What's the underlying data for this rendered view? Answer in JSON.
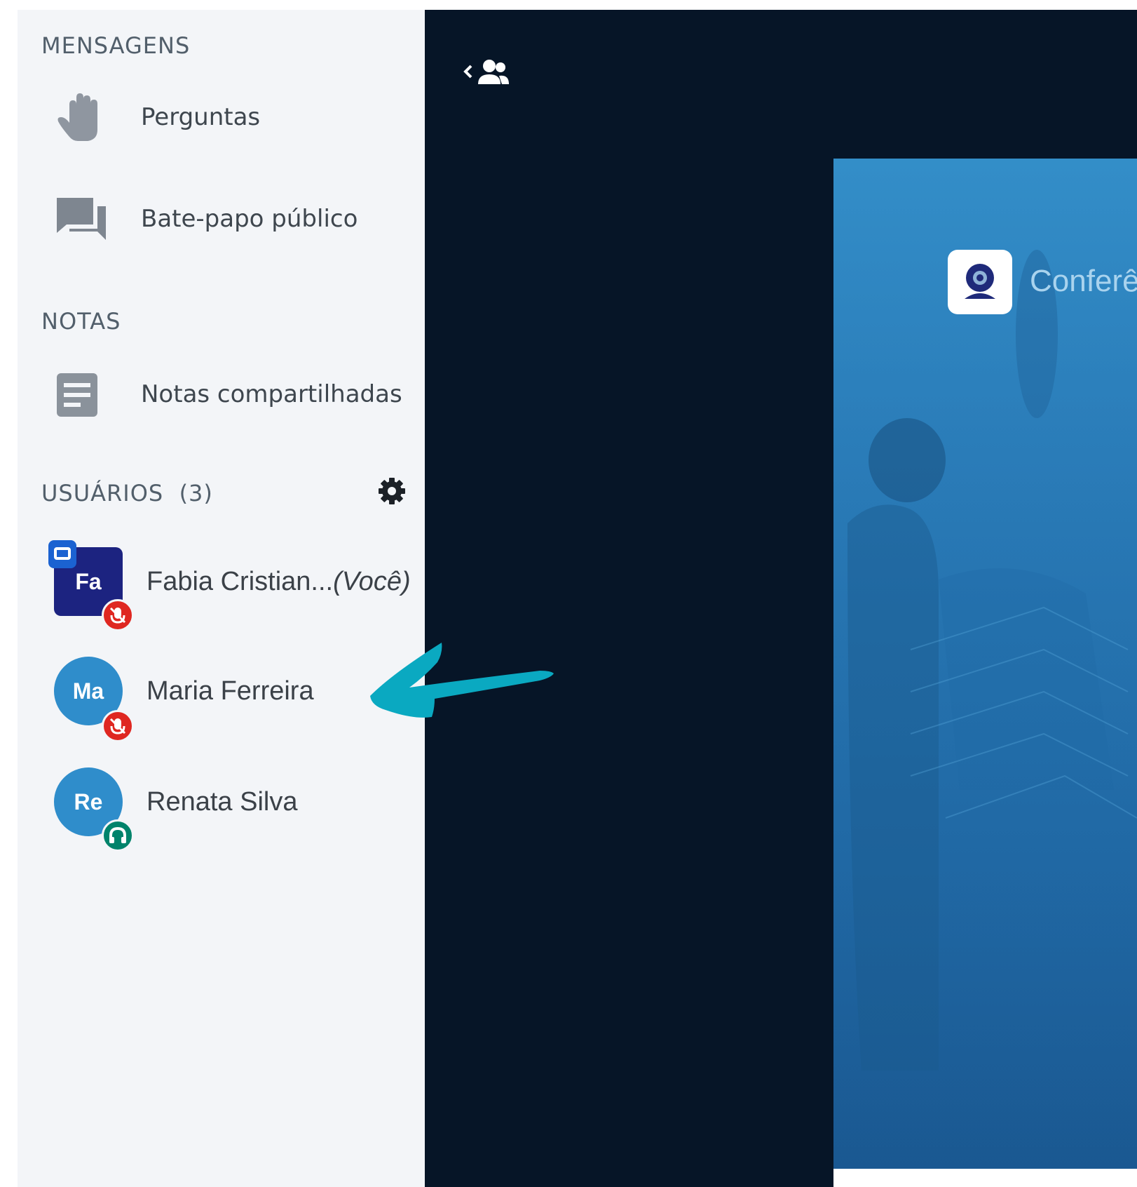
{
  "sidebar": {
    "messages_title": "MENSAGENS",
    "messages": [
      {
        "label": "Perguntas",
        "icon": "hand-icon"
      },
      {
        "label": "Bate-papo público",
        "icon": "chat-icon"
      }
    ],
    "notes_title": "NOTAS",
    "notes": [
      {
        "label": "Notas compartilhadas",
        "icon": "notes-icon"
      }
    ],
    "users_title": "USUÁRIOS",
    "users_count": "(3)",
    "users": [
      {
        "initials": "Fa",
        "name": "Fabia Cristian...",
        "suffix": "(Você)",
        "avatar_color": "#1c2380",
        "status": "microphone-muted",
        "status_color": "#df2721",
        "presenter": true
      },
      {
        "initials": "Ma",
        "name": "Maria Ferreira",
        "suffix": "",
        "avatar_color": "#2f8dcb",
        "status": "microphone-muted",
        "status_color": "#df2721",
        "presenter": false
      },
      {
        "initials": "Re",
        "name": "Renata Silva",
        "suffix": "",
        "avatar_color": "#2f8dcb",
        "status": "listen-only",
        "status_color": "#00836b",
        "presenter": false
      }
    ]
  },
  "main": {
    "presentation_title": "Conferê",
    "logo_icon": "webcam-logo-icon"
  },
  "colors": {
    "sidebar_bg": "#f3f5f8",
    "main_bg": "#061527",
    "arrow": "#0aa9c1"
  }
}
